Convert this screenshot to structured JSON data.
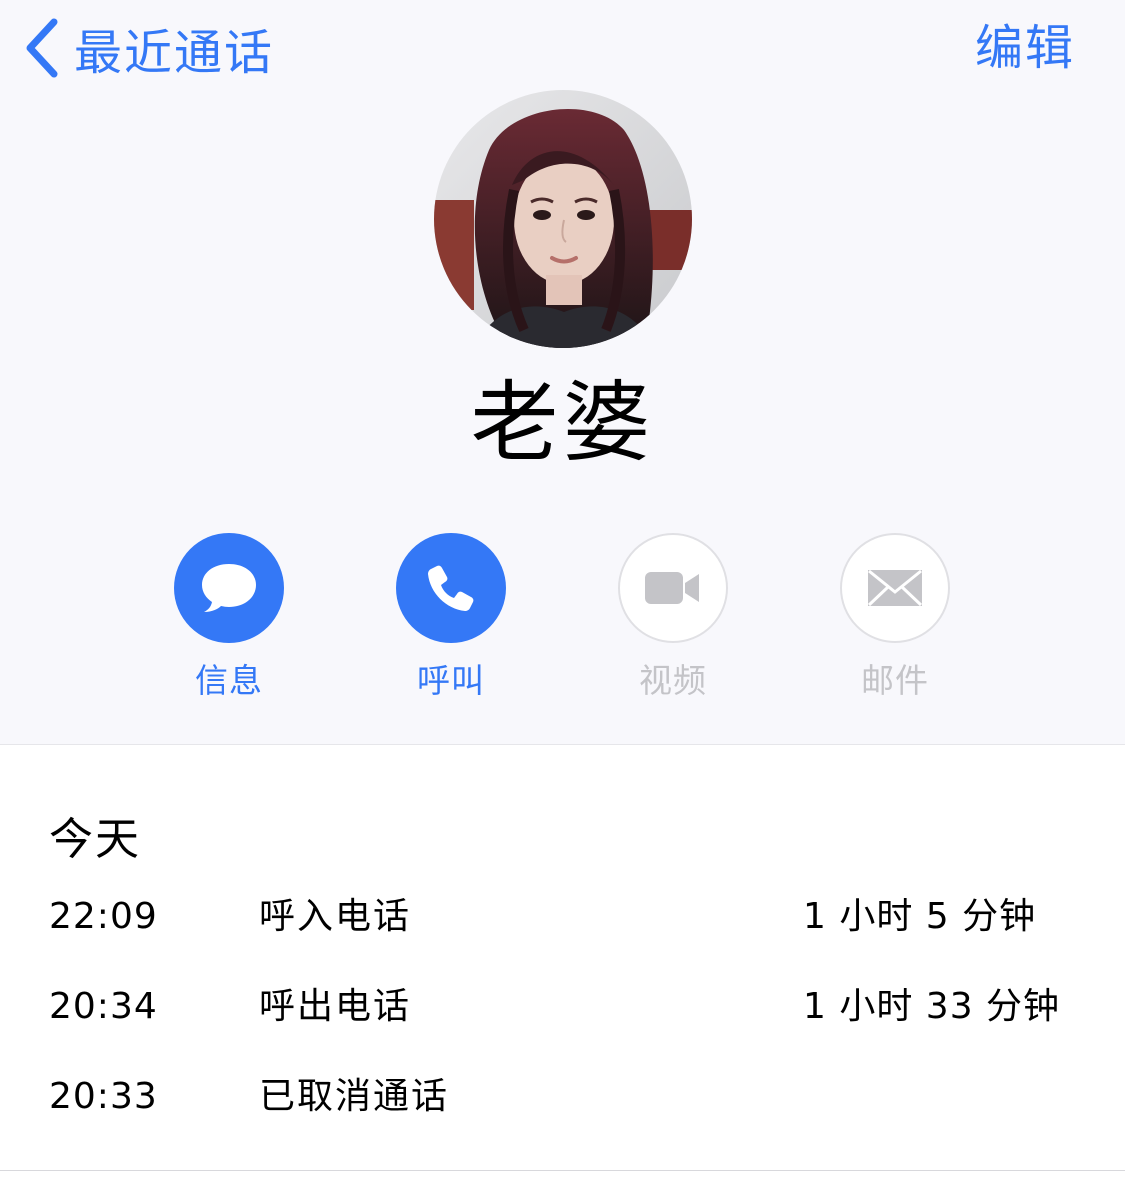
{
  "nav": {
    "back_label": "最近通话",
    "edit_label": "编辑"
  },
  "contact": {
    "name": "老婆"
  },
  "actions": [
    {
      "label": "信息",
      "icon": "message-bubble-icon",
      "enabled": true
    },
    {
      "label": "呼叫",
      "icon": "phone-icon",
      "enabled": true
    },
    {
      "label": "视频",
      "icon": "video-camera-icon",
      "enabled": false
    },
    {
      "label": "邮件",
      "icon": "envelope-icon",
      "enabled": false
    }
  ],
  "history": {
    "section_title": "今天",
    "calls": [
      {
        "time": "22:09",
        "type": "呼入电话",
        "duration": "1 小时 5 分钟"
      },
      {
        "time": "20:34",
        "type": "呼出电话",
        "duration": "1 小时 33 分钟"
      },
      {
        "time": "20:33",
        "type": "已取消通话",
        "duration": ""
      }
    ]
  },
  "colors": {
    "accent": "#3478f6",
    "disabled": "#c4c4c8",
    "header_background": "#f8f8fc"
  }
}
